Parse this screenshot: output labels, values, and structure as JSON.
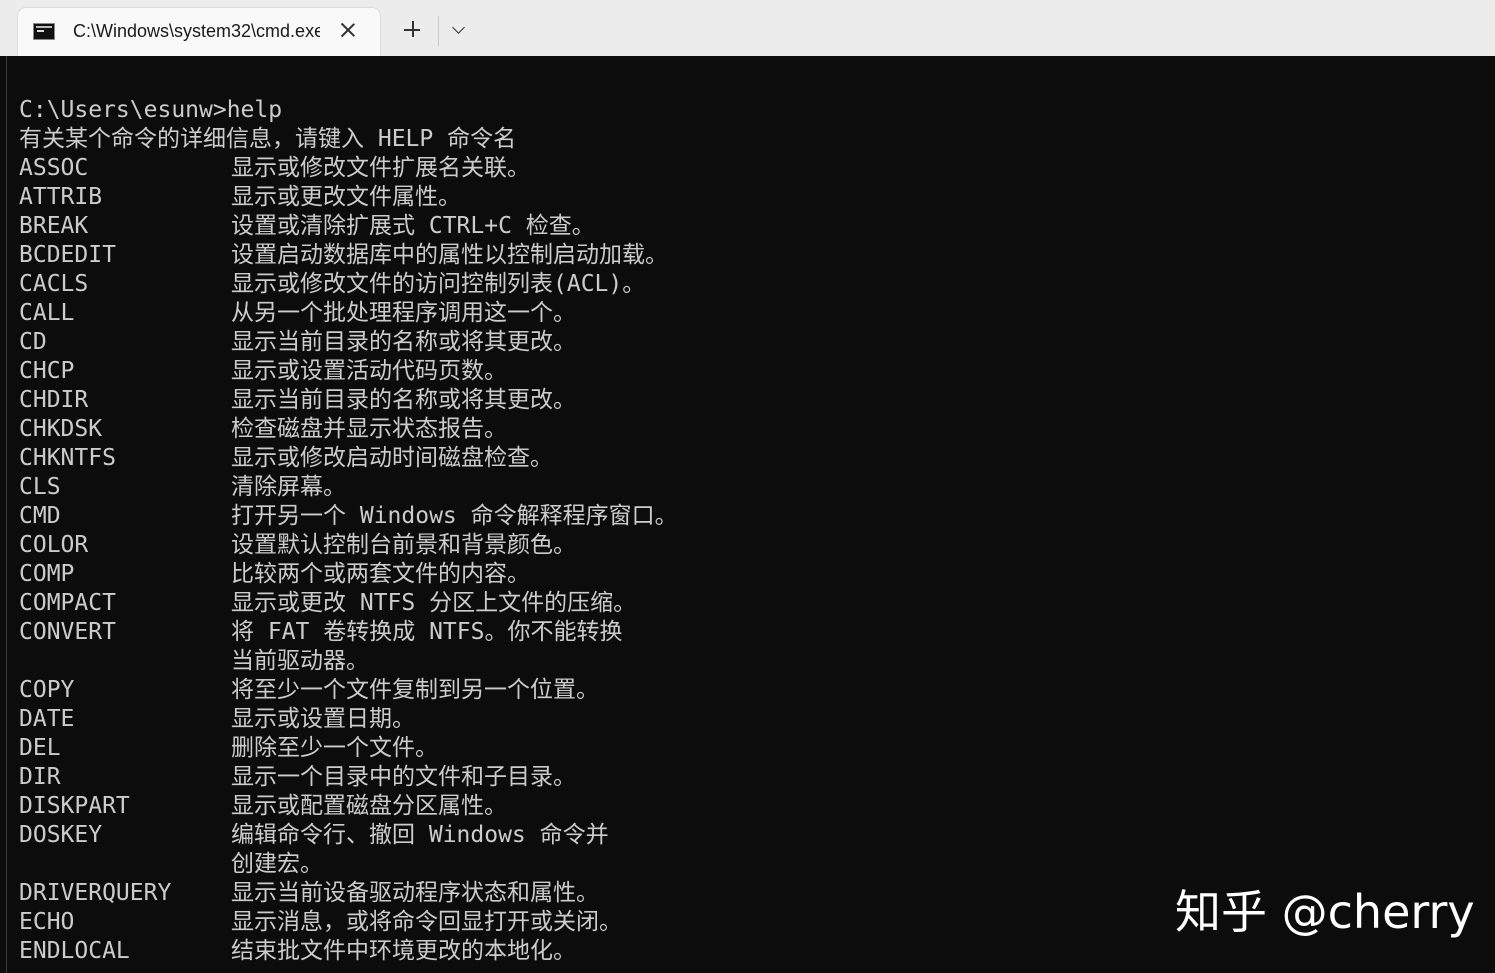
{
  "tab": {
    "title": "C:\\Windows\\system32\\cmd.exe"
  },
  "icons": {
    "tab": "terminal-icon",
    "close": "close-icon",
    "new_tab": "plus-icon",
    "dropdown": "chevron-down-icon"
  },
  "console": {
    "prompt_line": "C:\\Users\\esunw>help",
    "intro": "有关某个命令的详细信息，请键入 HELP 命令名",
    "commands": [
      {
        "name": "ASSOC",
        "desc": "显示或修改文件扩展名关联。"
      },
      {
        "name": "ATTRIB",
        "desc": "显示或更改文件属性。"
      },
      {
        "name": "BREAK",
        "desc": "设置或清除扩展式 CTRL+C 检查。"
      },
      {
        "name": "BCDEDIT",
        "desc": "设置启动数据库中的属性以控制启动加载。"
      },
      {
        "name": "CACLS",
        "desc": "显示或修改文件的访问控制列表(ACL)。"
      },
      {
        "name": "CALL",
        "desc": "从另一个批处理程序调用这一个。"
      },
      {
        "name": "CD",
        "desc": "显示当前目录的名称或将其更改。"
      },
      {
        "name": "CHCP",
        "desc": "显示或设置活动代码页数。"
      },
      {
        "name": "CHDIR",
        "desc": "显示当前目录的名称或将其更改。"
      },
      {
        "name": "CHKDSK",
        "desc": "检查磁盘并显示状态报告。"
      },
      {
        "name": "CHKNTFS",
        "desc": "显示或修改启动时间磁盘检查。"
      },
      {
        "name": "CLS",
        "desc": "清除屏幕。"
      },
      {
        "name": "CMD",
        "desc": "打开另一个 Windows 命令解释程序窗口。"
      },
      {
        "name": "COLOR",
        "desc": "设置默认控制台前景和背景颜色。"
      },
      {
        "name": "COMP",
        "desc": "比较两个或两套文件的内容。"
      },
      {
        "name": "COMPACT",
        "desc": "显示或更改 NTFS 分区上文件的压缩。"
      },
      {
        "name": "CONVERT",
        "desc": "将 FAT 卷转换成 NTFS。你不能转换"
      },
      {
        "name": "",
        "desc": "当前驱动器。"
      },
      {
        "name": "COPY",
        "desc": "将至少一个文件复制到另一个位置。"
      },
      {
        "name": "DATE",
        "desc": "显示或设置日期。"
      },
      {
        "name": "DEL",
        "desc": "删除至少一个文件。"
      },
      {
        "name": "DIR",
        "desc": "显示一个目录中的文件和子目录。"
      },
      {
        "name": "DISKPART",
        "desc": "显示或配置磁盘分区属性。"
      },
      {
        "name": "DOSKEY",
        "desc": "编辑命令行、撤回 Windows 命令并"
      },
      {
        "name": "",
        "desc": "创建宏。"
      },
      {
        "name": "DRIVERQUERY",
        "desc": "显示当前设备驱动程序状态和属性。"
      },
      {
        "name": "ECHO",
        "desc": "显示消息，或将命令回显打开或关闭。"
      },
      {
        "name": "ENDLOCAL",
        "desc": "结束批文件中环境更改的本地化。"
      }
    ]
  },
  "watermark": "知乎 @cherry",
  "colors": {
    "terminal_bg": "#0c0c0c",
    "terminal_fg": "#cccccc",
    "titlebar_bg": "#ececec",
    "tab_bg": "#f9f9f9"
  }
}
